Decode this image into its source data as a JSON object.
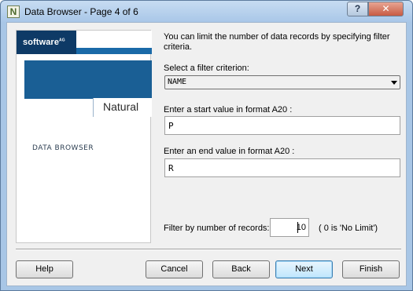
{
  "window": {
    "title": "Data Browser - Page 4 of 6",
    "app_icon_letter": "N",
    "help_glyph": "?",
    "close_glyph": "✕"
  },
  "branding": {
    "company_logo": "software",
    "company_logo_suffix": "AG",
    "product": "Natural",
    "module_label": "DATA BROWSER"
  },
  "form": {
    "description": "You can limit the number of data records by specifying filter criteria.",
    "criterion_label": "Select a filter criterion:",
    "criterion_value": "NAME",
    "start_label": "Enter a start value in format A20 :",
    "start_value": "P",
    "end_label": "Enter an end value in format A20 :",
    "end_value": "R",
    "count_label": "Filter by number of records:",
    "count_value": "10",
    "count_hint": "( 0 is 'No Limit')"
  },
  "buttons": {
    "help": "Help",
    "cancel": "Cancel",
    "back": "Back",
    "next": "Next",
    "finish": "Finish"
  }
}
